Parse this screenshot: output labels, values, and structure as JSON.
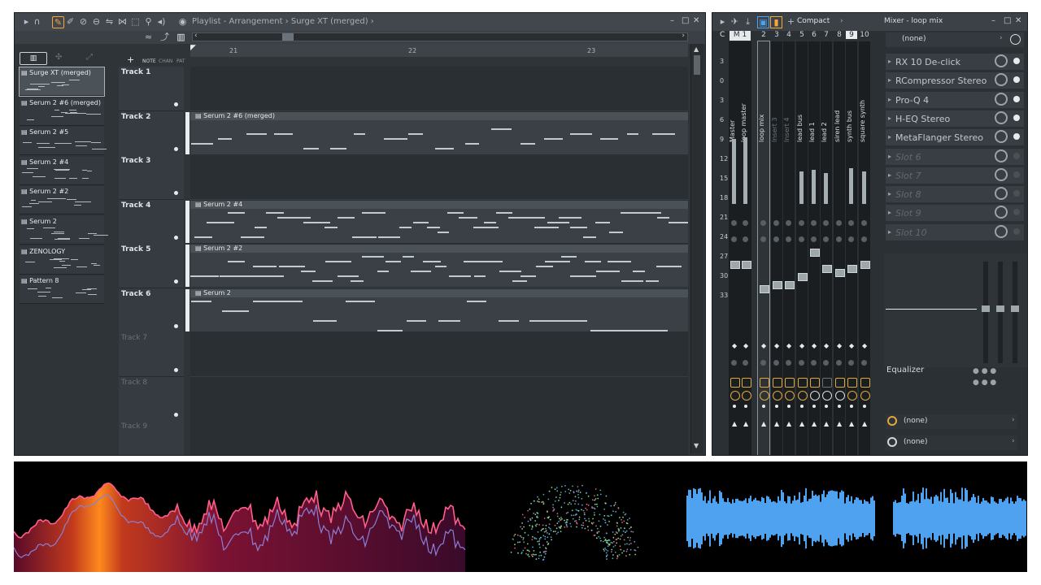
{
  "playlist": {
    "path": "Playlist - Arrangement › Surge XT (merged) ›",
    "bars": [
      "21",
      "22",
      "23"
    ],
    "track_header_labels": {
      "note": "NOTE",
      "chan": "CHAN",
      "pat": "PAT"
    },
    "picker_items": [
      {
        "name": "Surge XT (merged)",
        "selected": true
      },
      {
        "name": "Serum 2 #6 (merged)",
        "selected": false
      },
      {
        "name": "Serum 2 #5",
        "selected": false
      },
      {
        "name": "Serum 2 #4",
        "selected": false
      },
      {
        "name": "Serum 2 #2",
        "selected": false
      },
      {
        "name": "Serum 2",
        "selected": false
      },
      {
        "name": "ZENOLOGY",
        "selected": false
      },
      {
        "name": "Pattern 8",
        "selected": false
      }
    ],
    "tracks": [
      {
        "name": "Track 1",
        "clip": ""
      },
      {
        "name": "Track 2",
        "clip": "Serum 2 #6 (merged)"
      },
      {
        "name": "Track 3",
        "clip": ""
      },
      {
        "name": "Track 4",
        "clip": "Serum 2 #4"
      },
      {
        "name": "Track 5",
        "clip": "Serum 2 #2"
      },
      {
        "name": "Track 6",
        "clip": "Serum 2"
      },
      {
        "name": "Track 7",
        "clip": ""
      },
      {
        "name": "Track 8",
        "clip": ""
      },
      {
        "name": "Track 9",
        "clip": ""
      }
    ]
  },
  "mixer": {
    "title": "Mixer - loop mix",
    "view_mode": "Compact",
    "master_labels": {
      "m": "M",
      "one": "1"
    },
    "strips": [
      {
        "num": "",
        "name": "Master"
      },
      {
        "num": "",
        "name": "loop master"
      },
      {
        "num": "2",
        "name": "loop mix"
      },
      {
        "num": "3",
        "name": "Insert 3"
      },
      {
        "num": "4",
        "name": "Insert 4"
      },
      {
        "num": "5",
        "name": "lead bus"
      },
      {
        "num": "6",
        "name": "lead 1"
      },
      {
        "num": "7",
        "name": "lead 2"
      },
      {
        "num": "8",
        "name": "siren lead"
      },
      {
        "num": "9",
        "name": "synth bus"
      },
      {
        "num": "10",
        "name": "square synth"
      }
    ],
    "db_scale": [
      "3",
      "0",
      "3",
      "6",
      "9",
      "12",
      "15",
      "18",
      "21",
      "24",
      "27",
      "30",
      "33"
    ],
    "preset": "(none)",
    "slots": [
      {
        "name": "RX 10 De-click",
        "active": true
      },
      {
        "name": "RCompressor Stereo",
        "active": true
      },
      {
        "name": "Pro-Q 4",
        "active": true
      },
      {
        "name": "H-EQ Stereo",
        "active": true
      },
      {
        "name": "MetaFlanger Stereo",
        "active": true
      },
      {
        "name": "Slot 6",
        "active": false
      },
      {
        "name": "Slot 7",
        "active": false
      },
      {
        "name": "Slot 8",
        "active": false
      },
      {
        "name": "Slot 9",
        "active": false
      },
      {
        "name": "Slot 10",
        "active": false
      }
    ],
    "equalizer_label": "Equalizer",
    "input": "(none)",
    "output": "(none)"
  },
  "colors": {
    "accent": "#f3a83b",
    "waveform": "#4ea2f0",
    "spectrum": "#ff5e8a"
  }
}
